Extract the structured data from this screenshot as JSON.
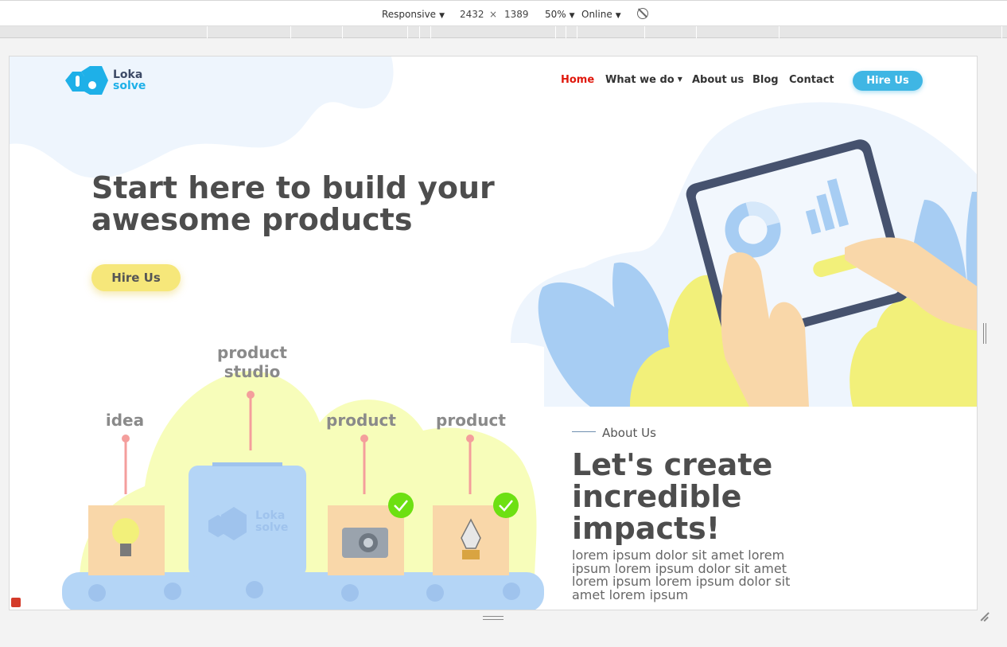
{
  "devtools": {
    "device": "Responsive",
    "width": "2432",
    "times": "×",
    "height": "1389",
    "zoom": "50%",
    "network": "Online"
  },
  "site": {
    "logo": {
      "line1": "Loka",
      "line2": "solve"
    },
    "nav": {
      "home": "Home",
      "what_we_do": "What we do",
      "about_us": "About us",
      "blog": "Blog",
      "contact": "Contact",
      "hire_us": "Hire Us"
    },
    "hero": {
      "title": "Start here to build your awesome products",
      "button": "Hire Us"
    },
    "illustration": {
      "label_product_studio": "product studio",
      "label_idea": "idea",
      "label_product_1": "product",
      "label_product_2": "product",
      "box_logo_line1": "Loka",
      "box_logo_line2": "solve"
    },
    "about": {
      "label": "About Us",
      "title": "Let's create incredible impacts!",
      "text": "lorem ipsum dolor sit amet lorem ipsum lorem ipsum dolor sit amet lorem ipsum lorem ipsum dolor sit amet lorem ipsum"
    }
  },
  "colors": {
    "nav_active": "#e0180c",
    "brand_blue": "#3fb6e4",
    "hero_button": "#f6e77a",
    "heading": "#4d4d4d"
  }
}
